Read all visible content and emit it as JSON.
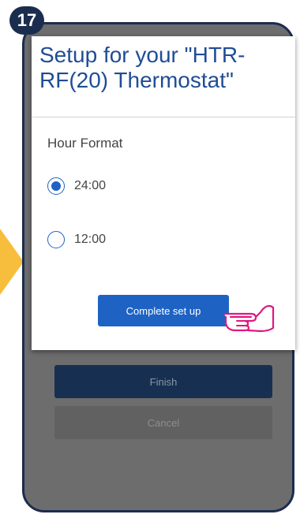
{
  "step": {
    "number": "17"
  },
  "dialog": {
    "title": "Setup for your \"HTR-RF(20) Thermostat\"",
    "section_label": "Hour Format",
    "options": [
      {
        "label": "24:00",
        "selected": true
      },
      {
        "label": "12:00",
        "selected": false
      }
    ],
    "complete_button": "Complete set up"
  },
  "background": {
    "finish_button": "Finish",
    "cancel_button": "Cancel"
  },
  "colors": {
    "accent": "#1e63c4",
    "title": "#1f4d95",
    "badge": "#1b2d4f",
    "arrow": "#f7be3e",
    "hand": "#e0187e"
  },
  "icons": [
    "radio-selected-icon",
    "radio-unselected-icon",
    "pointing-hand-icon",
    "side-arrow-icon"
  ]
}
